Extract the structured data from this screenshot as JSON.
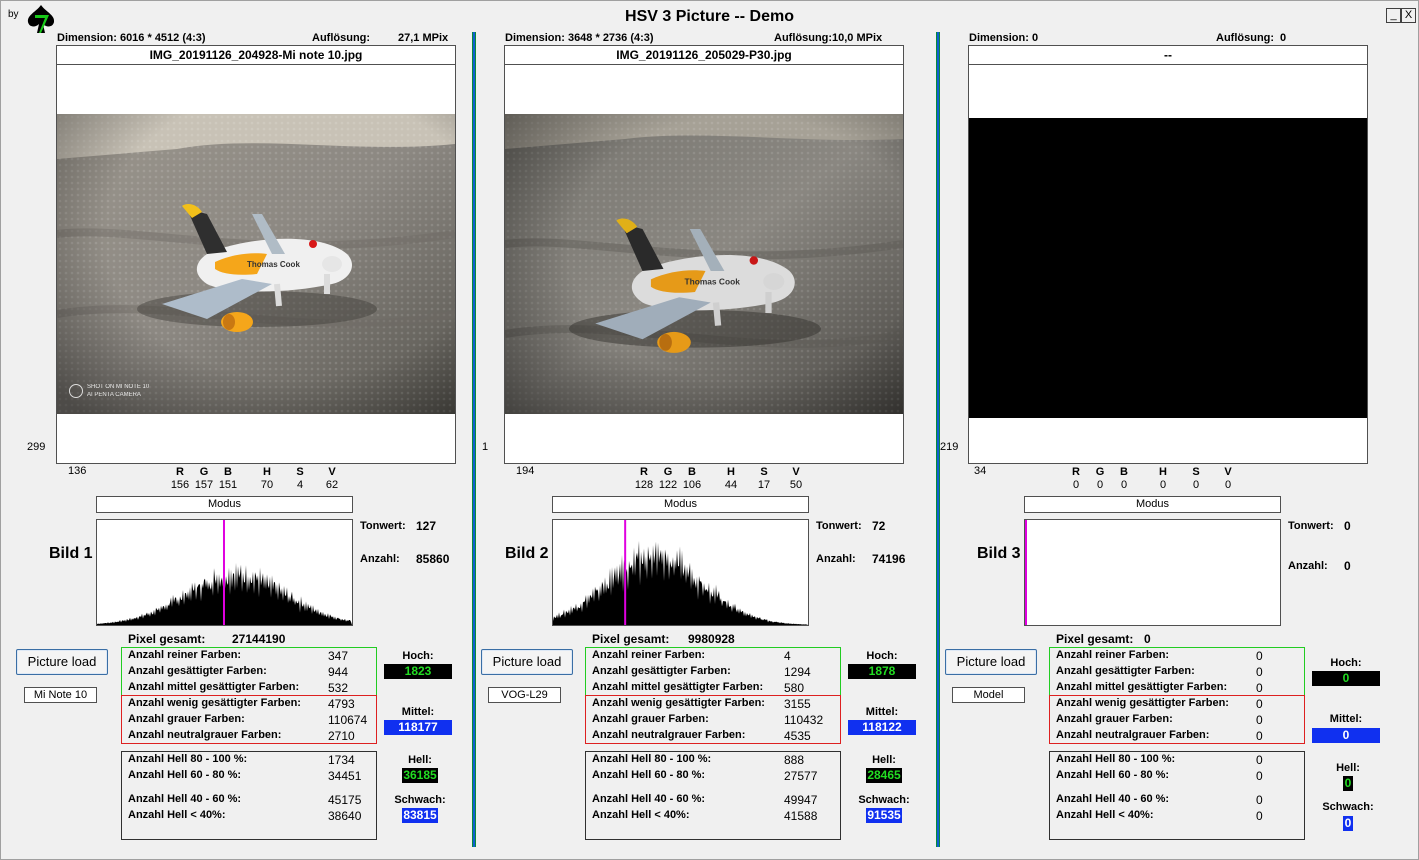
{
  "app": {
    "title": "HSV 3 Picture -- Demo",
    "by_label": "by",
    "minimize": "_",
    "close": "X"
  },
  "panels": [
    {
      "dimension": "Dimension: 6016 * 4512 (4:3)",
      "aufloesung_label": "Auflösung:",
      "aufloesung_value": "27,1 MPix",
      "filename": "IMG_20191126_204928-Mi note 10.jpg",
      "left_value": "299",
      "below_value": "136",
      "watermark_line1": "SHOT ON MI NOTE 10",
      "watermark_line2": "AI PENTA CAMERA",
      "rgb": {
        "R": "156",
        "G": "157",
        "B": "151",
        "H": "70",
        "S": "4",
        "V": "62"
      },
      "modus": "Modus",
      "bild": "Bild 1",
      "tonwert_label": "Tonwert:",
      "tonwert": "127",
      "anzahl_label": "Anzahl:",
      "anzahl": "85860",
      "pixel_label": "Pixel gesamt:",
      "pixel": "27144190",
      "button": "Picture load",
      "camera": "Mi Note 10",
      "green": [
        [
          "Anzahl reiner Farben:",
          "347"
        ],
        [
          "Anzahl gesättigter Farben:",
          "944"
        ],
        [
          "Anzahl mittel gesättigter Farben:",
          "532"
        ]
      ],
      "red": [
        [
          "Anzahl wenig gesättigter Farben:",
          "4793"
        ],
        [
          "Anzahl grauer Farben:",
          "110674"
        ],
        [
          "Anzahl neutralgrauer Farben:",
          "2710"
        ]
      ],
      "hell": [
        [
          "Anzahl Hell 80 - 100 %:",
          "1734"
        ],
        [
          "Anzahl Hell 60 - 80 %:",
          "34451"
        ],
        [
          "Anzahl Hell 40 - 60 %:",
          "45175"
        ],
        [
          "Anzahl Hell < 40%:",
          "38640"
        ]
      ],
      "hoch_label": "Hoch:",
      "hoch": "1823",
      "mittel_label": "Mittel:",
      "mittel": "118177",
      "hellS_label": "Hell:",
      "hellS": "36185",
      "schwach_label": "Schwach:",
      "schwach": "83815",
      "histogram": {
        "marker_fraction": 0.498,
        "center": 0.545,
        "spread": 0.2,
        "peak": 0.55
      }
    },
    {
      "dimension": "Dimension: 3648 * 2736 (4:3)",
      "aufloesung_label": "Auflösung:",
      "aufloesung_value": "10,0 MPix",
      "filename": "IMG_20191126_205029-P30.jpg",
      "left_value": "1",
      "below_value": "194",
      "watermark_line1": "",
      "watermark_line2": "",
      "rgb": {
        "R": "128",
        "G": "122",
        "B": "106",
        "H": "44",
        "S": "17",
        "V": "50"
      },
      "modus": "Modus",
      "bild": "Bild 2",
      "tonwert_label": "Tonwert:",
      "tonwert": "72",
      "anzahl_label": "Anzahl:",
      "anzahl": "74196",
      "pixel_label": "Pixel gesamt:",
      "pixel": "9980928",
      "button": "Picture load",
      "camera": "VOG-L29",
      "green": [
        [
          "Anzahl reiner Farben:",
          "4"
        ],
        [
          "Anzahl gesättigter Farben:",
          "1294"
        ],
        [
          "Anzahl mittel gesättigter Farben:",
          "580"
        ]
      ],
      "red": [
        [
          "Anzahl wenig gesättigter Farben:",
          "3155"
        ],
        [
          "Anzahl grauer Farben:",
          "110432"
        ],
        [
          "Anzahl neutralgrauer Farben:",
          "4535"
        ]
      ],
      "hell": [
        [
          "Anzahl Hell 80 - 100 %:",
          "888"
        ],
        [
          "Anzahl Hell 60 - 80 %:",
          "27577"
        ],
        [
          "Anzahl Hell 40 - 60 %:",
          "49947"
        ],
        [
          "Anzahl Hell < 40%:",
          "41588"
        ]
      ],
      "hoch_label": "Hoch:",
      "hoch": "1878",
      "mittel_label": "Mittel:",
      "mittel": "118122",
      "hellS_label": "Hell:",
      "hellS": "28465",
      "schwach_label": "Schwach:",
      "schwach": "91535",
      "histogram": {
        "marker_fraction": 0.283,
        "center": 0.4,
        "spread": 0.19,
        "peak": 0.75
      }
    },
    {
      "dimension": "Dimension: 0",
      "aufloesung_label": "Auflösung:",
      "aufloesung_value": "0",
      "filename": "--",
      "left_value": "219",
      "below_value": "34",
      "watermark_line1": "",
      "watermark_line2": "",
      "rgb": {
        "R": "0",
        "G": "0",
        "B": "0",
        "H": "0",
        "S": "0",
        "V": "0"
      },
      "modus": "Modus",
      "bild": "Bild 3",
      "tonwert_label": "Tonwert:",
      "tonwert": "0",
      "anzahl_label": "Anzahl:",
      "anzahl": "0",
      "pixel_label": "Pixel gesamt:",
      "pixel": "0",
      "button": "Picture load",
      "camera": "Model",
      "green": [
        [
          "Anzahl reiner Farben:",
          "0"
        ],
        [
          "Anzahl gesättigter Farben:",
          "0"
        ],
        [
          "Anzahl mittel gesättigter Farben:",
          "0"
        ]
      ],
      "red": [
        [
          "Anzahl wenig gesättigter Farben:",
          "0"
        ],
        [
          "Anzahl grauer Farben:",
          "0"
        ],
        [
          "Anzahl neutralgrauer Farben:",
          "0"
        ]
      ],
      "hell": [
        [
          "Anzahl Hell 80 - 100 %:",
          "0"
        ],
        [
          "Anzahl Hell 60 - 80 %:",
          "0"
        ],
        [
          "Anzahl Hell 40 - 60 %:",
          "0"
        ],
        [
          "Anzahl Hell < 40%:",
          "0"
        ]
      ],
      "hoch_label": "Hoch:",
      "hoch": "0",
      "mittel_label": "Mittel:",
      "mittel": "0",
      "hellS_label": "Hell:",
      "hellS": "0",
      "schwach_label": "Schwach:",
      "schwach": "0",
      "histogram": {
        "marker_fraction": 0.0,
        "center": 0,
        "spread": 0,
        "peak": 0
      }
    }
  ],
  "colors": {
    "separator": "#1060d0",
    "green_box": "#22cc22",
    "red_box": "#dd2020",
    "hoch_text": "#22dd22",
    "mittel_bg": "#1030f0",
    "marker": "#e000e0"
  }
}
